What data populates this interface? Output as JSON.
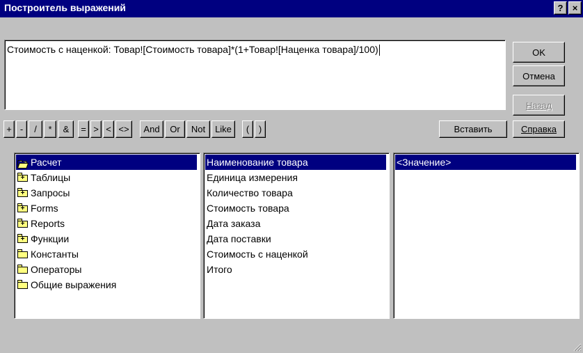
{
  "window": {
    "title": "Построитель выражений",
    "help_glyph": "?",
    "close_glyph": "×"
  },
  "expression": {
    "value": "Стоимость с наценкой: Товар![Стоимость товара]*(1+Товар![Наценка товара]/100)"
  },
  "buttons": {
    "ok": "OK",
    "cancel": "Отмена",
    "back": "Назад",
    "insert": "Вставить",
    "help": "Справка"
  },
  "operators": [
    "+",
    "-",
    "/",
    "*",
    "&",
    "=",
    ">",
    "<",
    "<>",
    "And",
    "Or",
    "Not",
    "Like",
    "(",
    ")"
  ],
  "left_list": [
    {
      "label": "Расчет",
      "icon": "open-folder-icon",
      "selected": true
    },
    {
      "label": "Таблицы",
      "icon": "folder-plus-icon",
      "selected": false
    },
    {
      "label": "Запросы",
      "icon": "folder-plus-icon",
      "selected": false
    },
    {
      "label": "Forms",
      "icon": "folder-plus-icon",
      "selected": false
    },
    {
      "label": "Reports",
      "icon": "folder-plus-icon",
      "selected": false
    },
    {
      "label": "Функции",
      "icon": "folder-plus-icon",
      "selected": false
    },
    {
      "label": "Константы",
      "icon": "folder-icon",
      "selected": false
    },
    {
      "label": "Операторы",
      "icon": "folder-icon",
      "selected": false
    },
    {
      "label": "Общие выражения",
      "icon": "folder-icon",
      "selected": false
    }
  ],
  "middle_list": [
    {
      "label": "Наименование товара",
      "selected": true
    },
    {
      "label": "Единица измерения",
      "selected": false
    },
    {
      "label": "Количество товара",
      "selected": false
    },
    {
      "label": "Стоимость товара",
      "selected": false
    },
    {
      "label": "Дата заказа",
      "selected": false
    },
    {
      "label": "Дата поставки",
      "selected": false
    },
    {
      "label": "Стоимость с наценкой",
      "selected": false
    },
    {
      "label": "Итого",
      "selected": false
    }
  ],
  "right_list": [
    {
      "label": "<Значение>",
      "selected": true
    }
  ],
  "colors": {
    "titlebar": "#000080",
    "face": "#c0c0c0",
    "selection": "#000080"
  }
}
